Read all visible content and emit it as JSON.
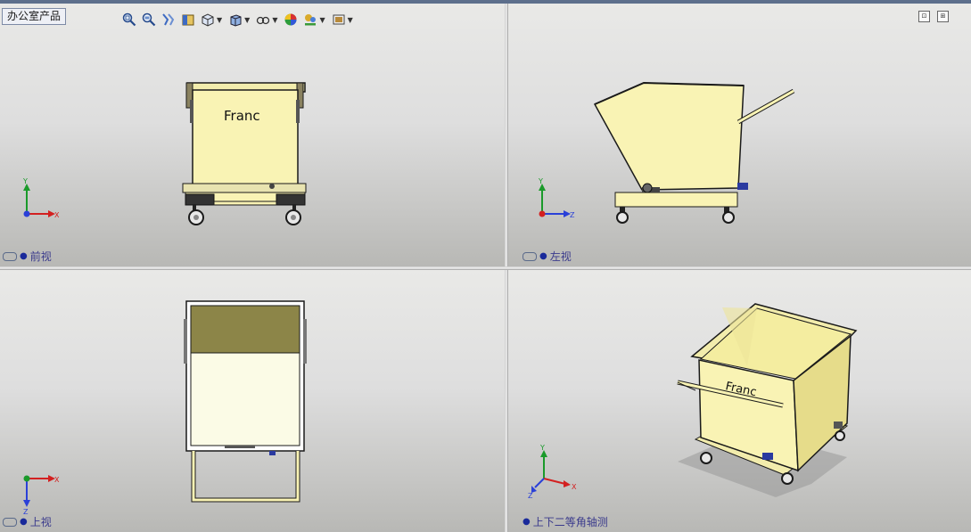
{
  "window": {
    "tree_tab": "办公室产品"
  },
  "toolbar": {
    "icons": [
      "zoom-to-fit-icon",
      "zoom-area-icon",
      "previous-view-icon",
      "section-view-icon",
      "view-orientation-icon",
      "display-style-icon",
      "hide-show-items-icon",
      "edit-appearance-icon",
      "apply-scene-icon",
      "view-settings-icon"
    ]
  },
  "viewports": {
    "front": {
      "label": "前视",
      "axes": {
        "vertical": "Y",
        "horizontal": "X"
      }
    },
    "left": {
      "label": "左视",
      "axes": {
        "vertical": "Y",
        "horizontal": "Z"
      }
    },
    "top": {
      "label": "上视",
      "axes": {
        "vertical": "Z",
        "horizontal": "X"
      }
    },
    "iso": {
      "label": "上下二等角轴测",
      "axes": {
        "vertical": "Y",
        "horizontal": "X",
        "depth": "Z"
      }
    }
  },
  "model": {
    "label_text": "Franc"
  },
  "colors": {
    "body_fill": "#f9f3b4",
    "outline": "#1a1a1a",
    "axis_x": "#d32020",
    "axis_y": "#1a9a2a",
    "axis_z": "#2a40d8",
    "label": "#3a3a8c"
  }
}
